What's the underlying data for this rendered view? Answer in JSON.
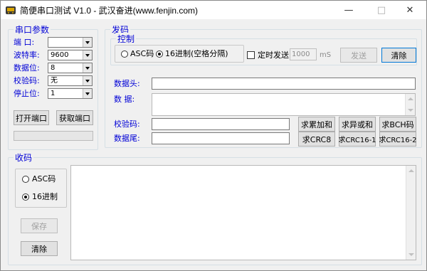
{
  "window": {
    "title": "简便串口测试 V1.0 - 武汉奋进(www.fenjin.com)",
    "minimize_icon": "minimize-icon",
    "maximize_icon": "maximize-icon",
    "close_icon": "close-icon"
  },
  "serial": {
    "group_title": "串口参数",
    "port_label": "端  口:",
    "port_value": "",
    "baud_label": "波特率:",
    "baud_value": "9600",
    "databits_label": "数据位:",
    "databits_value": "8",
    "parity_label": "校验码:",
    "parity_value": "无",
    "stopbits_label": "停止位:",
    "stopbits_value": "1",
    "open_button": "打开端口",
    "get_button": "获取端口",
    "progress": 0
  },
  "send": {
    "group_title": "发码",
    "control_title": "控制",
    "asc_label": "ASC码",
    "hex_label": "16进制(空格分隔)",
    "mode_selected": "hex",
    "timed_label": "定时发送",
    "timed_checked": false,
    "interval_value": "1000",
    "interval_unit": "mS",
    "send_button": "发送",
    "clear_button": "清除",
    "header_label": "数据头:",
    "data_label": "数  据:",
    "check_label": "校验码:",
    "tail_label": "数据尾:",
    "header_value": "",
    "data_value": "",
    "check_value": "",
    "tail_value": "",
    "sum_button": "求累加和",
    "xor_button": "求异或和",
    "bcc_button": "求BCH码",
    "crc8_button": "求CRC8",
    "crc16_1_button": "求CRC16-1",
    "crc16_2_button": "求CRC16-2"
  },
  "receive": {
    "group_title": "收码",
    "asc_label": "ASC码",
    "hex_label": "16进制",
    "mode_selected": "hex",
    "save_button": "保存",
    "clear_button": "清除",
    "content": ""
  },
  "colors": {
    "label_blue": "#0000d6",
    "window_bg": "#f0f0f0",
    "focus_border": "#0078d7"
  }
}
